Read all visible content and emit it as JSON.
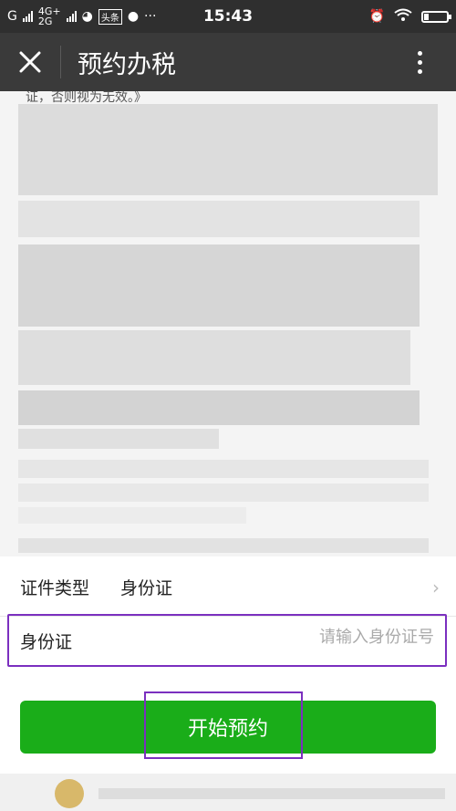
{
  "status_bar": {
    "carrier1": "G",
    "network_top": "4G+",
    "network_bottom": "2G",
    "news_badge": "头条",
    "time": "15:43"
  },
  "title_bar": {
    "title": "预约办税"
  },
  "content": {
    "top_line": "证，否则视为无效。》"
  },
  "form": {
    "id_type_label": "证件类型",
    "id_type_value": "身份证",
    "id_label": "身份证",
    "id_placeholder": "请输入身份证号"
  },
  "actions": {
    "start_label": "开始预约"
  }
}
